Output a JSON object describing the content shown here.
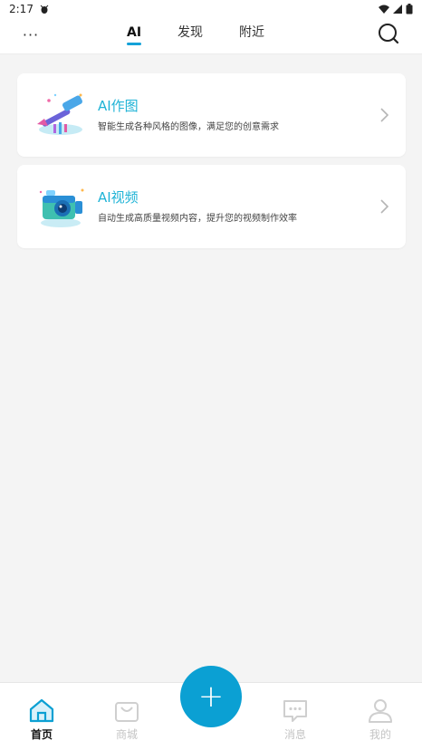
{
  "status_bar": {
    "time": "2:17",
    "notification_icon": "bug-icon"
  },
  "top_nav": {
    "tabs": [
      {
        "label": "AI",
        "active": true
      },
      {
        "label": "发现",
        "active": false
      },
      {
        "label": "附近",
        "active": false
      }
    ],
    "more_label": "···"
  },
  "cards": [
    {
      "title": "AI作图",
      "description": "智能生成各种风格的图像，满足您的创意需求",
      "icon": "paintbrush-art-icon"
    },
    {
      "title": "AI视频",
      "description": "自动生成高质量视频内容，提升您的视频制作效率",
      "icon": "camera-art-icon"
    }
  ],
  "bottom_nav": {
    "items": [
      {
        "label": "首页",
        "icon": "home-icon",
        "active": true
      },
      {
        "label": "商城",
        "icon": "shopping-bag-icon",
        "active": false
      },
      {
        "label": "消息",
        "icon": "message-icon",
        "active": false
      },
      {
        "label": "我的",
        "icon": "profile-icon",
        "active": false
      }
    ],
    "fab_label": "+"
  },
  "colors": {
    "accent": "#0ba0d3",
    "title": "#1fb3d6",
    "background": "#f4f4f4"
  }
}
